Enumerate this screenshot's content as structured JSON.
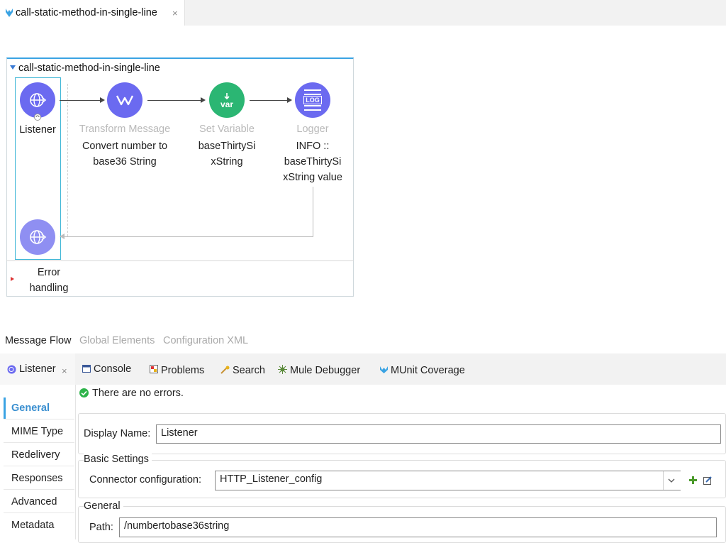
{
  "editor": {
    "tab_label": "call-static-method-in-single-line",
    "close_glyph": "×"
  },
  "flow": {
    "name": "call-static-method-in-single-line",
    "nodes": [
      {
        "type": "",
        "label": "Listener",
        "icon": "http-listener-icon",
        "color": "#6b6af0"
      },
      {
        "type": "Transform Message",
        "label": "Convert number to base36 String",
        "icon": "dataweave-icon",
        "color": "#6b6af0"
      },
      {
        "type": "Set Variable",
        "label": "baseThirtySi xString",
        "icon": "var-icon",
        "color": "#2bb673"
      },
      {
        "type": "Logger",
        "label": "INFO :: baseThirtySi xString value",
        "icon": "log-icon",
        "color": "#6b6af0"
      }
    ],
    "node_labels": {
      "listener": "Listener",
      "transform_type": "Transform Message",
      "transform_line1": "Convert number to",
      "transform_line2": "base36 String",
      "setvar_type": "Set Variable",
      "setvar_line1": "baseThirtySi",
      "setvar_line2": "xString",
      "logger_type": "Logger",
      "logger_line1": "INFO ::",
      "logger_line2": "baseThirtySi",
      "logger_line3": "xString value",
      "var_text": "var",
      "log_text": "LOG"
    },
    "error_handling_line1": "Error",
    "error_handling_line2": "handling"
  },
  "canvas_tabs": {
    "message_flow": "Message Flow",
    "global_elements": "Global Elements",
    "configuration_xml": "Configuration XML"
  },
  "panel": {
    "properties_tab": "Listener",
    "console_tab": "Console",
    "problems_tab": "Problems",
    "search_tab": "Search",
    "debugger_tab": "Mule Debugger",
    "munit_tab": "MUnit Coverage",
    "status_message": "There are no errors."
  },
  "sidebar": {
    "items": [
      "General",
      "MIME Type",
      "Redelivery",
      "Responses",
      "Advanced",
      "Metadata"
    ]
  },
  "form": {
    "display_name_label": "Display Name:",
    "display_name_value": "Listener",
    "basic_settings_title": "Basic Settings",
    "connector_config_label": "Connector configuration:",
    "connector_config_value": "HTTP_Listener_config",
    "general_title": "General",
    "path_label": "Path:",
    "path_value": "/numbertobase36string"
  },
  "colors": {
    "accent": "#3aa3e3",
    "node_purple": "#6b6af0",
    "node_green": "#2bb673",
    "status_ok": "#2db34a"
  }
}
